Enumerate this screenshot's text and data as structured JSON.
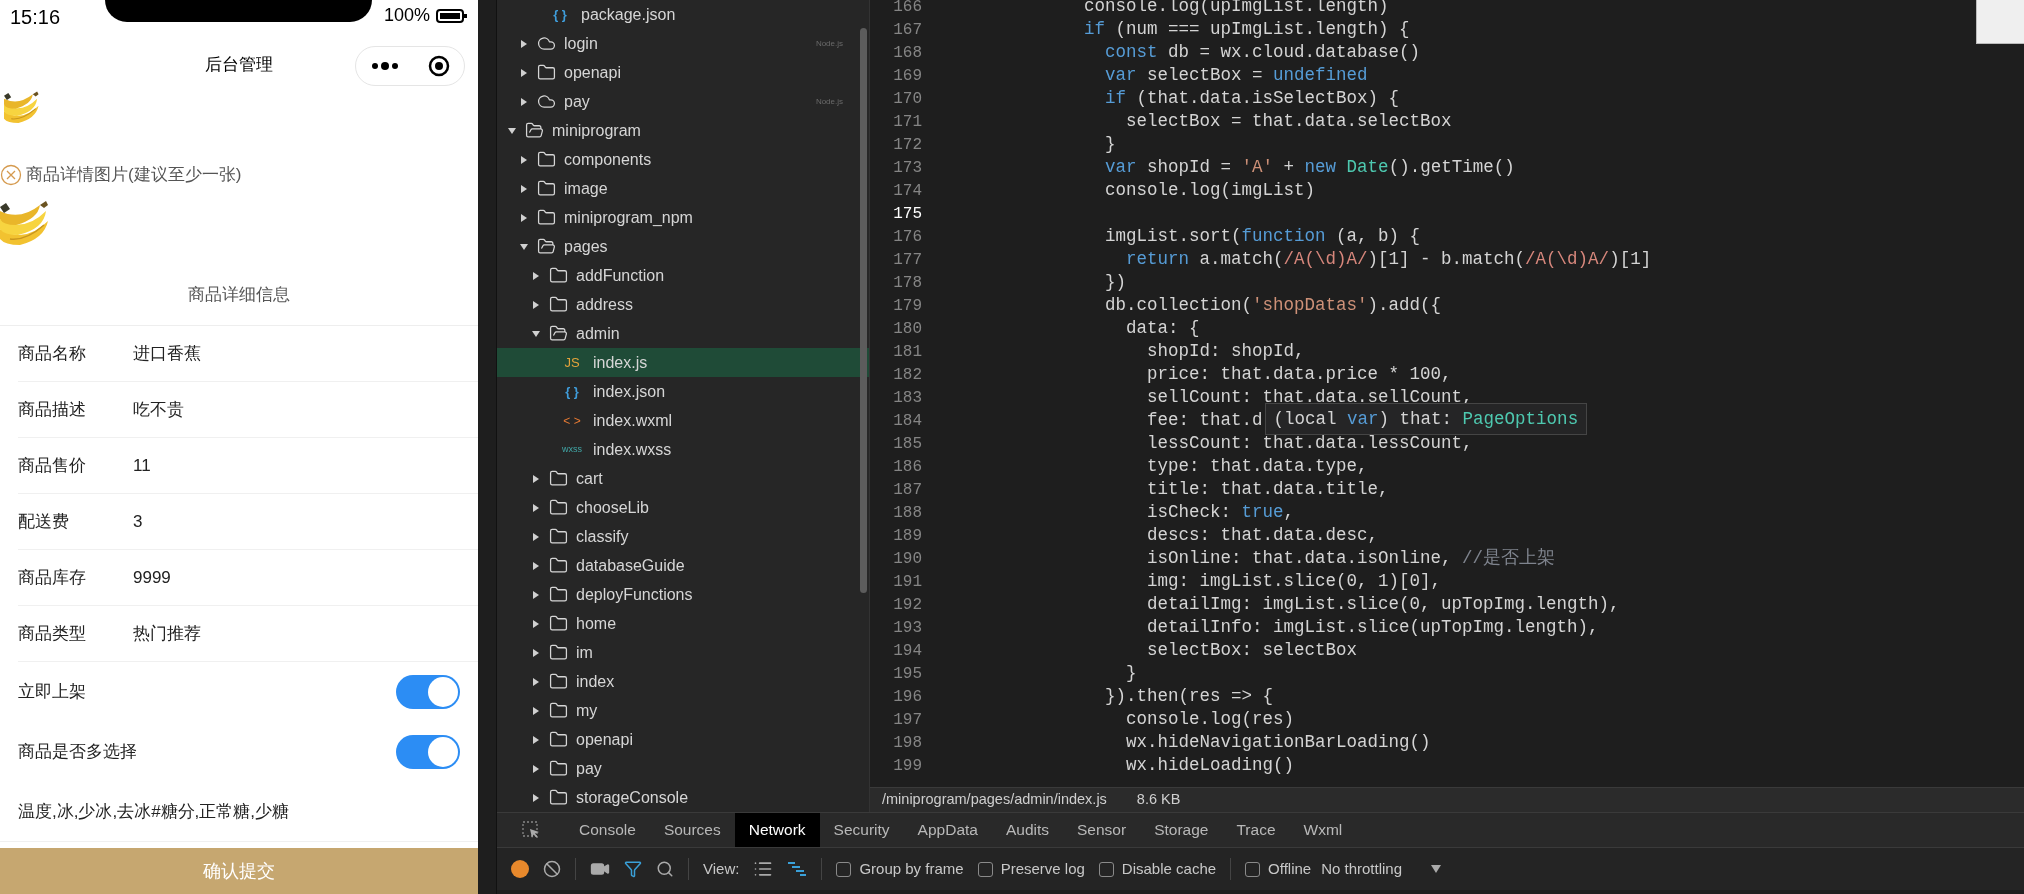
{
  "phone": {
    "status_bar": {
      "time": "15:16",
      "battery": "100%"
    },
    "nav": {
      "title": "后台管理"
    },
    "detail_images_label": "商品详情图片(建议至少一张)",
    "section_title": "商品详细信息",
    "fields": [
      {
        "kind": "text",
        "label": "商品名称",
        "value": "进口香蕉"
      },
      {
        "kind": "text",
        "label": "商品描述",
        "value": "吃不贵"
      },
      {
        "kind": "text",
        "label": "商品售价",
        "value": "11"
      },
      {
        "kind": "text",
        "label": "配送费",
        "value": "3"
      },
      {
        "kind": "text",
        "label": "商品库存",
        "value": "9999"
      },
      {
        "kind": "text",
        "label": "商品类型",
        "value": "热门推荐"
      },
      {
        "kind": "switch",
        "label": "立即上架",
        "on": true
      },
      {
        "kind": "switch",
        "label": "商品是否多选择",
        "on": true
      }
    ],
    "options_text": "温度,冰,少冰,去冰#糖分,正常糖,少糖",
    "submit": "确认提交"
  },
  "tree": [
    {
      "children": [
        {
          "children": [
            {
              "kind": "json",
              "icon": "{ }",
              "label": "package.json",
              "selected": false
            }
          ]
        },
        {
          "kind": "cloud",
          "label": "login",
          "badge": "Node.js",
          "expanded": false,
          "selected": false
        },
        {
          "kind": "folder",
          "label": "openapi",
          "expanded": false,
          "selected": false
        },
        {
          "kind": "cloud",
          "label": "pay",
          "badge": "Node.js",
          "expanded": false,
          "selected": false
        }
      ]
    },
    {
      "kind": "folder",
      "label": "miniprogram",
      "expanded": true,
      "selected": false,
      "children": [
        {
          "kind": "folder",
          "label": "components",
          "expanded": false,
          "selected": false
        },
        {
          "kind": "folder",
          "label": "image",
          "expanded": false,
          "selected": false
        },
        {
          "kind": "folder",
          "label": "miniprogram_npm",
          "expanded": false,
          "selected": false
        },
        {
          "kind": "folder",
          "label": "pages",
          "expanded": true,
          "selected": false,
          "children": [
            {
              "kind": "folder",
              "label": "addFunction",
              "expanded": false,
              "selected": false
            },
            {
              "kind": "folder",
              "label": "address",
              "expanded": false,
              "selected": false
            },
            {
              "kind": "folder",
              "label": "admin",
              "expanded": true,
              "selected": false,
              "children": [
                {
                  "kind": "js",
                  "icon": "JS",
                  "label": "index.js",
                  "selected": true
                },
                {
                  "kind": "json",
                  "icon": "{ }",
                  "label": "index.json",
                  "selected": false
                },
                {
                  "kind": "wxml",
                  "icon": "< >",
                  "label": "index.wxml",
                  "selected": false
                },
                {
                  "kind": "wxss",
                  "icon": "wxss",
                  "label": "index.wxss",
                  "selected": false
                }
              ]
            },
            {
              "kind": "folder",
              "label": "cart",
              "expanded": false,
              "selected": false
            },
            {
              "kind": "folder",
              "label": "chooseLib",
              "expanded": false,
              "selected": false
            },
            {
              "kind": "folder",
              "label": "classify",
              "expanded": false,
              "selected": false
            },
            {
              "kind": "folder",
              "label": "databaseGuide",
              "expanded": false,
              "selected": false
            },
            {
              "kind": "folder",
              "label": "deployFunctions",
              "expanded": false,
              "selected": false
            },
            {
              "kind": "folder",
              "label": "home",
              "expanded": false,
              "selected": false
            },
            {
              "kind": "folder",
              "label": "im",
              "expanded": false,
              "selected": false
            },
            {
              "kind": "folder",
              "label": "index",
              "expanded": false,
              "selected": false
            },
            {
              "kind": "folder",
              "label": "my",
              "expanded": false,
              "selected": false
            },
            {
              "kind": "folder",
              "label": "openapi",
              "expanded": false,
              "selected": false
            },
            {
              "kind": "folder",
              "label": "pay",
              "expanded": false,
              "selected": false
            },
            {
              "kind": "folder",
              "label": "storageConsole",
              "expanded": false,
              "selected": false
            }
          ]
        }
      ]
    }
  ],
  "editor": {
    "lines": [
      {
        "number": "166",
        "current": false,
        "tokens": [
          {
            "kind": "plain",
            "text": "            console.log(upImgList.length)"
          }
        ]
      },
      {
        "number": "167",
        "current": false,
        "tokens": [
          {
            "kind": "keyword",
            "text": "            if"
          },
          {
            "kind": "plain",
            "text": " (num === upImgList.length) {"
          }
        ]
      },
      {
        "number": "168",
        "current": false,
        "tokens": [
          {
            "kind": "keyword",
            "text": "              const"
          },
          {
            "kind": "plain",
            "text": " db = wx.cloud.database()"
          }
        ]
      },
      {
        "number": "169",
        "current": false,
        "tokens": [
          {
            "kind": "keyword",
            "text": "              var"
          },
          {
            "kind": "plain",
            "text": " selectBox = "
          },
          {
            "kind": "keyword",
            "text": "undefined"
          }
        ]
      },
      {
        "number": "170",
        "current": false,
        "tokens": [
          {
            "kind": "keyword",
            "text": "              if"
          },
          {
            "kind": "plain",
            "text": " (that.data.isSelectBox) {"
          }
        ]
      },
      {
        "number": "171",
        "current": false,
        "tokens": [
          {
            "kind": "plain",
            "text": "                selectBox = that.data.selectBox"
          }
        ]
      },
      {
        "number": "172",
        "current": false,
        "tokens": [
          {
            "kind": "plain",
            "text": "              }"
          }
        ]
      },
      {
        "number": "173",
        "current": false,
        "tokens": [
          {
            "kind": "keyword",
            "text": "              var"
          },
          {
            "kind": "plain",
            "text": " shopId = "
          },
          {
            "kind": "string",
            "text": "'A'"
          },
          {
            "kind": "plain",
            "text": " + "
          },
          {
            "kind": "keyword",
            "text": "new "
          },
          {
            "kind": "type",
            "text": "Date"
          },
          {
            "kind": "plain",
            "text": "().getTime()"
          }
        ]
      },
      {
        "number": "174",
        "current": false,
        "tokens": [
          {
            "kind": "plain",
            "text": "              console.log(imgList)"
          }
        ]
      },
      {
        "number": "175",
        "current": true
      },
      {
        "number": "176",
        "current": false,
        "tokens": [
          {
            "kind": "plain",
            "text": "              imgList.sort("
          },
          {
            "kind": "keyword",
            "text": "function"
          },
          {
            "kind": "plain",
            "text": " (a, b) {"
          }
        ]
      },
      {
        "number": "177",
        "current": false,
        "tokens": [
          {
            "kind": "keyword",
            "text": "                return"
          },
          {
            "kind": "plain",
            "text": " a.match("
          },
          {
            "kind": "regex",
            "text": "/A(\\d)A/"
          },
          {
            "kind": "plain",
            "text": ")[1] - b.match("
          },
          {
            "kind": "regex",
            "text": "/A(\\d)A/"
          },
          {
            "kind": "plain",
            "text": ")[1]"
          }
        ]
      },
      {
        "number": "178",
        "current": false,
        "tokens": [
          {
            "kind": "plain",
            "text": "              })"
          }
        ]
      },
      {
        "number": "179",
        "current": false,
        "tokens": [
          {
            "kind": "plain",
            "text": "              db.collection("
          },
          {
            "kind": "string",
            "text": "'shopDatas'"
          },
          {
            "kind": "plain",
            "text": ").add({"
          }
        ]
      },
      {
        "number": "180",
        "current": false,
        "tokens": [
          {
            "kind": "plain",
            "text": "                data: {"
          }
        ]
      },
      {
        "number": "181",
        "current": false,
        "tokens": [
          {
            "kind": "plain",
            "text": "                  shopId: shopId,"
          }
        ]
      },
      {
        "number": "182",
        "current": false,
        "tokens": [
          {
            "kind": "plain",
            "text": "                  price: that.data.price * 100,"
          }
        ]
      },
      {
        "number": "183",
        "current": false,
        "tokens": [
          {
            "kind": "plain",
            "text": "                  sellCount: that.data.sellCount,"
          }
        ]
      },
      {
        "number": "184",
        "current": false,
        "tokens": [
          {
            "kind": "plain",
            "text": "                  fee: that.d"
          }
        ],
        "tooltip": [
          {
            "kind": "plain",
            "text": "(local "
          },
          {
            "kind": "keyword",
            "text": "var"
          },
          {
            "kind": "plain",
            "text": ") that: "
          },
          {
            "kind": "type",
            "text": "PageOptions"
          }
        ]
      },
      {
        "number": "185",
        "current": false,
        "tokens": [
          {
            "kind": "plain",
            "text": "                  lessCount: that.data.lessCount,"
          }
        ]
      },
      {
        "number": "186",
        "current": false,
        "tokens": [
          {
            "kind": "plain",
            "text": "                  type: that.data.type,"
          }
        ]
      },
      {
        "number": "187",
        "current": false,
        "tokens": [
          {
            "kind": "plain",
            "text": "                  title: that.data.title,"
          }
        ]
      },
      {
        "number": "188",
        "current": false,
        "tokens": [
          {
            "kind": "plain",
            "text": "                  isCheck: "
          },
          {
            "kind": "keyword",
            "text": "true"
          },
          {
            "kind": "plain",
            "text": ","
          }
        ]
      },
      {
        "number": "189",
        "current": false,
        "tokens": [
          {
            "kind": "plain",
            "text": "                  descs: that.data.desc,"
          }
        ]
      },
      {
        "number": "190",
        "current": false,
        "tokens": [
          {
            "kind": "plain",
            "text": "                  isOnline: that.data.isOnline, "
          },
          {
            "kind": "comment",
            "text": "//是否上架"
          }
        ]
      },
      {
        "number": "191",
        "current": false,
        "tokens": [
          {
            "kind": "plain",
            "text": "                  img: imgList.slice(0, 1)[0],"
          }
        ]
      },
      {
        "number": "192",
        "current": false,
        "tokens": [
          {
            "kind": "plain",
            "text": "                  detailImg: imgList.slice(0, upTopImg.length),"
          }
        ]
      },
      {
        "number": "193",
        "current": false,
        "tokens": [
          {
            "kind": "plain",
            "text": "                  detailInfo: imgList.slice(upTopImg.length),"
          }
        ]
      },
      {
        "number": "194",
        "current": false,
        "tokens": [
          {
            "kind": "plain",
            "text": "                  selectBox: selectBox"
          }
        ]
      },
      {
        "number": "195",
        "current": false,
        "tokens": [
          {
            "kind": "plain",
            "text": "                }"
          }
        ]
      },
      {
        "number": "196",
        "current": false,
        "tokens": [
          {
            "kind": "plain",
            "text": "              }).then(res => {"
          }
        ]
      },
      {
        "number": "197",
        "current": false,
        "tokens": [
          {
            "kind": "plain",
            "text": "                console.log(res)"
          }
        ]
      },
      {
        "number": "198",
        "current": false,
        "tokens": [
          {
            "kind": "plain",
            "text": "                wx.hideNavigationBarLoading()"
          }
        ]
      },
      {
        "number": "199",
        "current": false,
        "tokens": [
          {
            "kind": "plain",
            "text": "                wx.hideLoading()"
          }
        ]
      }
    ],
    "status": {
      "file_path": "/miniprogram/pages/admin/index.js",
      "file_size": "8.6 KB"
    }
  },
  "devtools": {
    "tabs": [
      {
        "label": "Console",
        "selected": false
      },
      {
        "label": "Sources",
        "selected": false
      },
      {
        "label": "Network",
        "selected": true
      },
      {
        "label": "Security",
        "selected": false
      },
      {
        "label": "AppData",
        "selected": false
      },
      {
        "label": "Audits",
        "selected": false
      },
      {
        "label": "Sensor",
        "selected": false
      },
      {
        "label": "Storage",
        "selected": false
      },
      {
        "label": "Trace",
        "selected": false
      },
      {
        "label": "Wxml",
        "selected": false
      }
    ],
    "toolbar": {
      "view_label": "View:",
      "checkboxes": [
        {
          "label": "Group by frame",
          "checked": false
        },
        {
          "label": "Preserve log",
          "checked": false
        },
        {
          "label": "Disable cache",
          "checked": false
        }
      ],
      "offline": {
        "label": "Offline",
        "checked": false
      },
      "throttling": "No throttling"
    }
  }
}
